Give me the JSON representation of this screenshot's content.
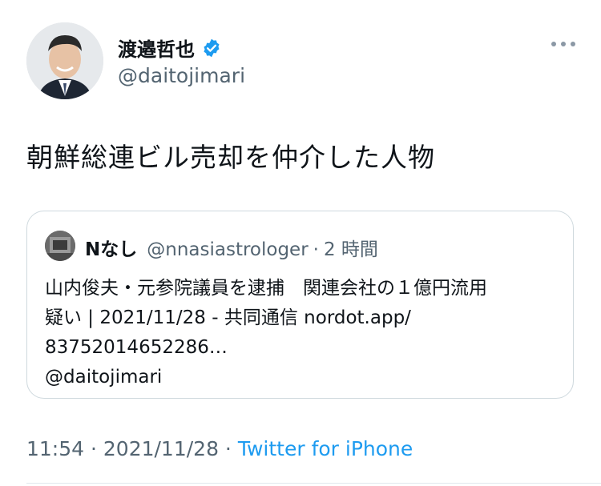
{
  "author": {
    "display_name": "渡邉哲也",
    "handle": "@daitojimari",
    "verified": true
  },
  "tweet": {
    "text": "朝鮮総連ビル売却を仲介した人物"
  },
  "quoted_tweet": {
    "display_name": "Nなし",
    "handle": "@nnasiastrologer",
    "separator": "·",
    "time": "2 時間",
    "text_lines": [
      "山内俊夫・元参院議員を逮捕　関連会社の１億円流用",
      "疑い | 2021/11/28 - 共同通信 nordot.app/",
      "83752014652286…",
      "@daitojimari"
    ]
  },
  "meta": {
    "time": "11:54",
    "sep1": " · ",
    "date": "2021/11/28",
    "sep2": " · ",
    "source": "Twitter for iPhone"
  },
  "colors": {
    "verified_blue": "#1d9bf0",
    "link_blue": "#1d9bf0",
    "secondary_text": "#536471"
  }
}
